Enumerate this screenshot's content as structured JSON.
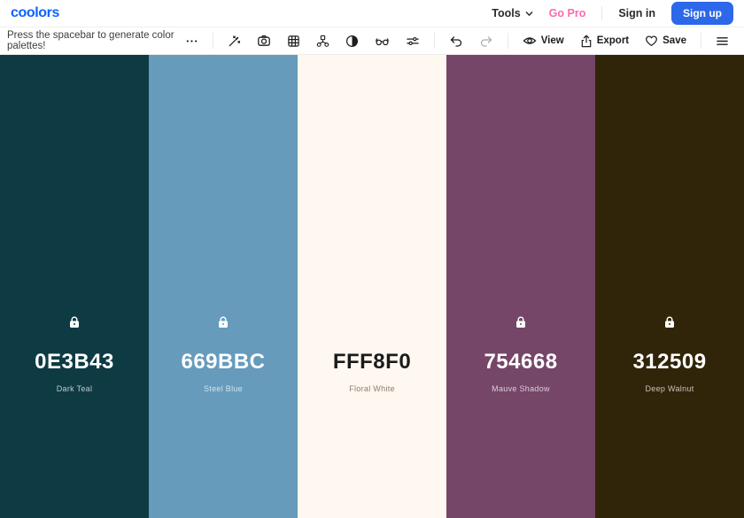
{
  "header": {
    "logo": "coolors",
    "tools_label": "Tools",
    "go_pro_label": "Go Pro",
    "sign_in_label": "Sign in",
    "sign_up_label": "Sign up",
    "brand_blue": "#0a63ff",
    "pro_pink": "#fa6bae",
    "signup_blue": "#2c68e9"
  },
  "toolbar": {
    "hint": "Press the spacebar to generate color palettes!",
    "view_label": "View",
    "export_label": "Export",
    "save_label": "Save",
    "icon_names": [
      "more-options",
      "magic-wand",
      "camera",
      "grid",
      "visualizer-nodes",
      "contrast",
      "color-blindness-glasses",
      "adjust-sliders",
      "undo",
      "redo",
      "eye",
      "export",
      "heart",
      "menu"
    ]
  },
  "palette": {
    "columns": [
      {
        "hex": "0E3B43",
        "name": "Dark Teal",
        "color": "#0E3B43",
        "locked": true,
        "text": "light"
      },
      {
        "hex": "669BBC",
        "name": "Steel Blue",
        "color": "#669BBC",
        "locked": true,
        "text": "light"
      },
      {
        "hex": "FFF8F0",
        "name": "Floral White",
        "color": "#FFF8F0",
        "locked": false,
        "text": "dark"
      },
      {
        "hex": "754668",
        "name": "Mauve Shadow",
        "color": "#754668",
        "locked": true,
        "text": "light"
      },
      {
        "hex": "312509",
        "name": "Deep Walnut",
        "color": "#312509",
        "locked": true,
        "text": "light"
      }
    ]
  }
}
